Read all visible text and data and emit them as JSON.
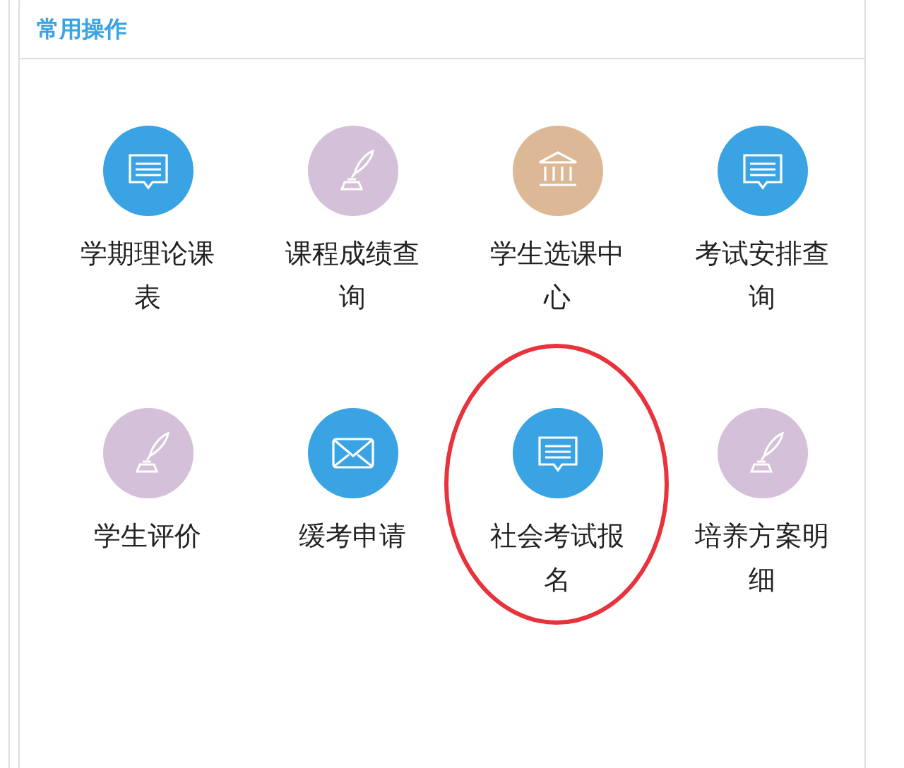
{
  "panel": {
    "title": "常用操作"
  },
  "shortcuts": [
    {
      "label": "学期理论课表",
      "kind": "chat",
      "circled": false
    },
    {
      "label": "课程成绩查询",
      "kind": "quill",
      "circled": false
    },
    {
      "label": "学生选课中心",
      "kind": "bank",
      "circled": false
    },
    {
      "label": "考试安排查询",
      "kind": "chat",
      "circled": false
    },
    {
      "label": "学生评价",
      "kind": "quill",
      "circled": false
    },
    {
      "label": "缓考申请",
      "kind": "mail",
      "circled": false
    },
    {
      "label": "社会考试报名",
      "kind": "chat",
      "circled": true
    },
    {
      "label": "培养方案明细",
      "kind": "quill",
      "circled": false
    }
  ]
}
